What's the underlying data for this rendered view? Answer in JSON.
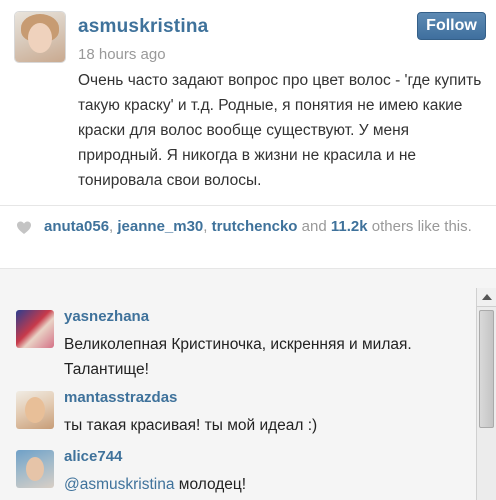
{
  "post": {
    "username": "asmuskristina",
    "follow_label": "Follow",
    "timestamp": "18 hours ago",
    "caption": "Очень часто задают вопрос про цвет волос - 'где купить такую краску' и т.д. Родные, я понятия не имею какие краски для волос вообще существуют. У меня природный. Я никогда в жизни не красила и не тонировала свои волосы."
  },
  "likes": {
    "icon": "heart-icon",
    "users": [
      "anuta056",
      "jeanne_m30",
      "trutchencko"
    ],
    "separator": ", ",
    "and_text": " and ",
    "count": "11.2k",
    "suffix": " others like this."
  },
  "comments": [
    {
      "username": "yasnezhana",
      "text": "Великолепная Кристиночка, искренняя и милая. Талантище!"
    },
    {
      "username": "mantasstrazdas",
      "text": "ты такая красивая! ты мой идеал :)"
    },
    {
      "username": "alice744",
      "mention": "@asmuskristina",
      "text": " молодец!"
    }
  ],
  "colors": {
    "link_blue": "#3f729b",
    "follow_button": "#4a7aa8",
    "muted_text": "#999999",
    "comments_bg": "#f5f5f5"
  }
}
